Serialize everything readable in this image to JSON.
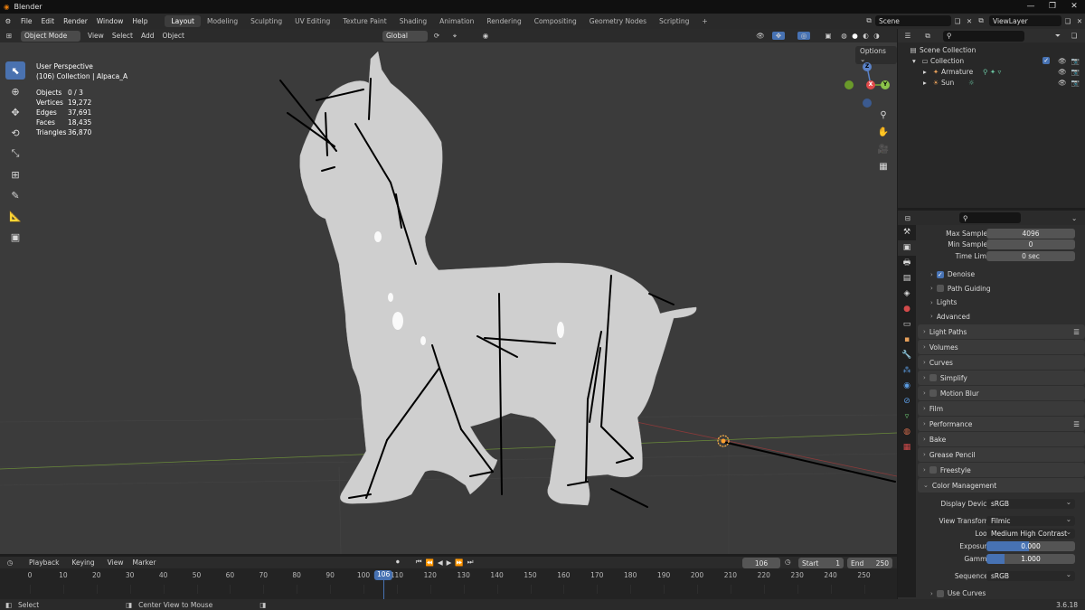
{
  "app": {
    "title": "Blender",
    "version": "3.6.18"
  },
  "menus": [
    "File",
    "Edit",
    "Render",
    "Window",
    "Help"
  ],
  "workspaces": [
    "Layout",
    "Modeling",
    "Sculpting",
    "UV Editing",
    "Texture Paint",
    "Shading",
    "Animation",
    "Rendering",
    "Compositing",
    "Geometry Nodes",
    "Scripting"
  ],
  "active_workspace": "Layout",
  "scene": {
    "name": "Scene",
    "view_layer": "ViewLayer"
  },
  "viewport": {
    "mode": "Object Mode",
    "menus": [
      "View",
      "Select",
      "Add",
      "Object"
    ],
    "orientation": "Global",
    "options_label": "Options",
    "view_name": "User Perspective",
    "collection_info": "(106) Collection | Alpaca_A",
    "stats": [
      {
        "k": "Objects",
        "v": "0 / 3"
      },
      {
        "k": "Vertices",
        "v": "19,272"
      },
      {
        "k": "Edges",
        "v": "37,691"
      },
      {
        "k": "Faces",
        "v": "18,435"
      },
      {
        "k": "Triangles",
        "v": "36,870"
      }
    ],
    "gizmo": {
      "x": "X",
      "y": "Y",
      "z": "Z"
    }
  },
  "outliner": {
    "root": "Scene Collection",
    "collection": "Collection",
    "items": [
      "Armature",
      "Sun"
    ]
  },
  "properties": {
    "sampling": [
      {
        "label": "Max Samples",
        "value": "4096"
      },
      {
        "label": "Min Samples",
        "value": "0"
      },
      {
        "label": "Time Limit",
        "value": "0 sec"
      }
    ],
    "subpanels": [
      {
        "label": "Denoise",
        "checkbox": true,
        "checked": true
      },
      {
        "label": "Path Guiding",
        "checkbox": true,
        "checked": false
      },
      {
        "label": "Lights",
        "checkbox": false
      },
      {
        "label": "Advanced",
        "checkbox": false
      }
    ],
    "panels": [
      {
        "label": "Light Paths",
        "checkbox": false,
        "list_icon": true
      },
      {
        "label": "Volumes",
        "checkbox": false
      },
      {
        "label": "Curves",
        "checkbox": false
      },
      {
        "label": "Simplify",
        "checkbox": true
      },
      {
        "label": "Motion Blur",
        "checkbox": true
      },
      {
        "label": "Film",
        "checkbox": false
      },
      {
        "label": "Performance",
        "checkbox": false,
        "list_icon": true
      },
      {
        "label": "Bake",
        "checkbox": false
      },
      {
        "label": "Grease Pencil",
        "checkbox": false
      },
      {
        "label": "Freestyle",
        "checkbox": true
      }
    ],
    "color_management": {
      "title": "Color Management",
      "display_device_label": "Display Device",
      "display_device": "sRGB",
      "view_transform_label": "View Transform",
      "view_transform": "Filmic",
      "look_label": "Look",
      "look": "Medium High Contrast",
      "exposure_label": "Exposure",
      "exposure": "0.000",
      "gamma_label": "Gamma",
      "gamma": "1.000",
      "sequencer_label": "Sequencer",
      "sequencer": "sRGB",
      "use_curves": "Use Curves"
    }
  },
  "timeline": {
    "menus": [
      "Playback",
      "Keying",
      "View",
      "Marker"
    ],
    "current_frame": "106",
    "start_label": "Start",
    "start": "1",
    "end_label": "End",
    "end": "250",
    "ticks": [
      "0",
      "10",
      "20",
      "30",
      "40",
      "50",
      "60",
      "70",
      "80",
      "90",
      "100",
      "110",
      "120",
      "130",
      "140",
      "150",
      "160",
      "170",
      "180",
      "190",
      "200",
      "210",
      "220",
      "230",
      "240",
      "250"
    ]
  },
  "statusbar": {
    "select": "Select",
    "center": "Center View to Mouse"
  }
}
